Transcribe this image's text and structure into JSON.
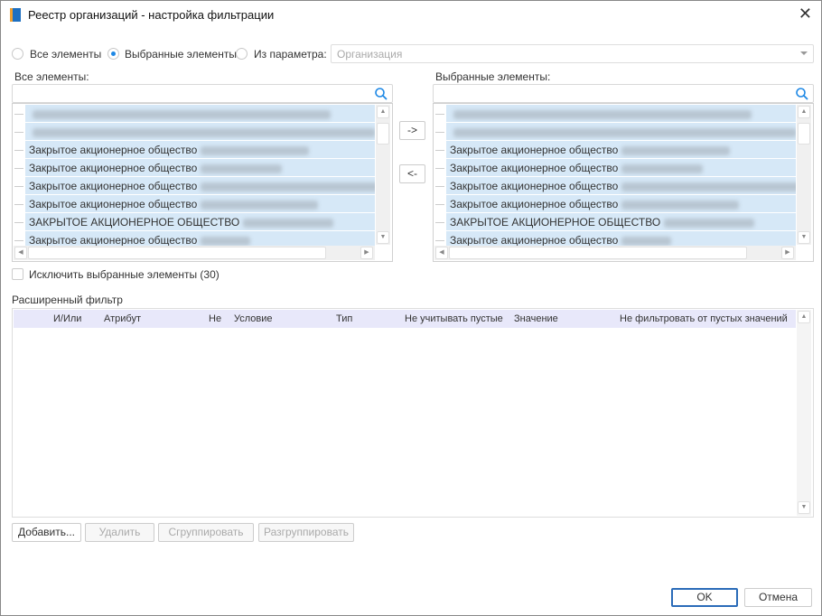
{
  "window": {
    "title": "Реестр организаций - настройка фильтрации",
    "icon": "registry-icon",
    "close": "✕"
  },
  "source": {
    "options": [
      "Все элементы",
      "Выбранные элементы",
      "Из параметра:"
    ],
    "selected": 1,
    "param_placeholder": "Организация"
  },
  "all_list": {
    "label": "Все элементы:",
    "rows": [
      "",
      "",
      "Закрытое акционерное общество",
      "Закрытое акционерное общество",
      "Закрытое акционерное общество",
      "Закрытое акционерное общество",
      "ЗАКРЫТОЕ АКЦИОНЕРНОЕ ОБЩЕСТВО",
      "Закрытое акционерное общество"
    ]
  },
  "selected_list": {
    "label": "Выбранные элементы:",
    "rows": [
      "",
      "",
      "Закрытое акционерное общество",
      "Закрытое акционерное общество",
      "Закрытое акционерное общество",
      "Закрытое акционерное общество",
      "ЗАКРЫТОЕ АКЦИОНЕРНОЕ ОБЩЕСТВО",
      "Закрытое акционерное общество"
    ]
  },
  "move": {
    "add": "->",
    "remove": "<-"
  },
  "exclude": {
    "label": "Исключить выбранные элементы (30)",
    "checked": false
  },
  "filter": {
    "label": "Расширенный фильтр",
    "columns": [
      "И/Или",
      "Атрибут",
      "Не",
      "Условие",
      "Тип",
      "Не учитывать пустые",
      "Значение",
      "Не фильтровать от пустых значений"
    ]
  },
  "filter_buttons": {
    "add": "Добавить...",
    "delete": "Удалить",
    "group": "Сгруппировать",
    "ungroup": "Разгруппировать"
  },
  "dialog": {
    "ok": "OK",
    "cancel": "Отмена"
  },
  "colors": {
    "accent": "#1e88e5",
    "row": "#d6e8f7",
    "header": "#e8e8fa"
  }
}
